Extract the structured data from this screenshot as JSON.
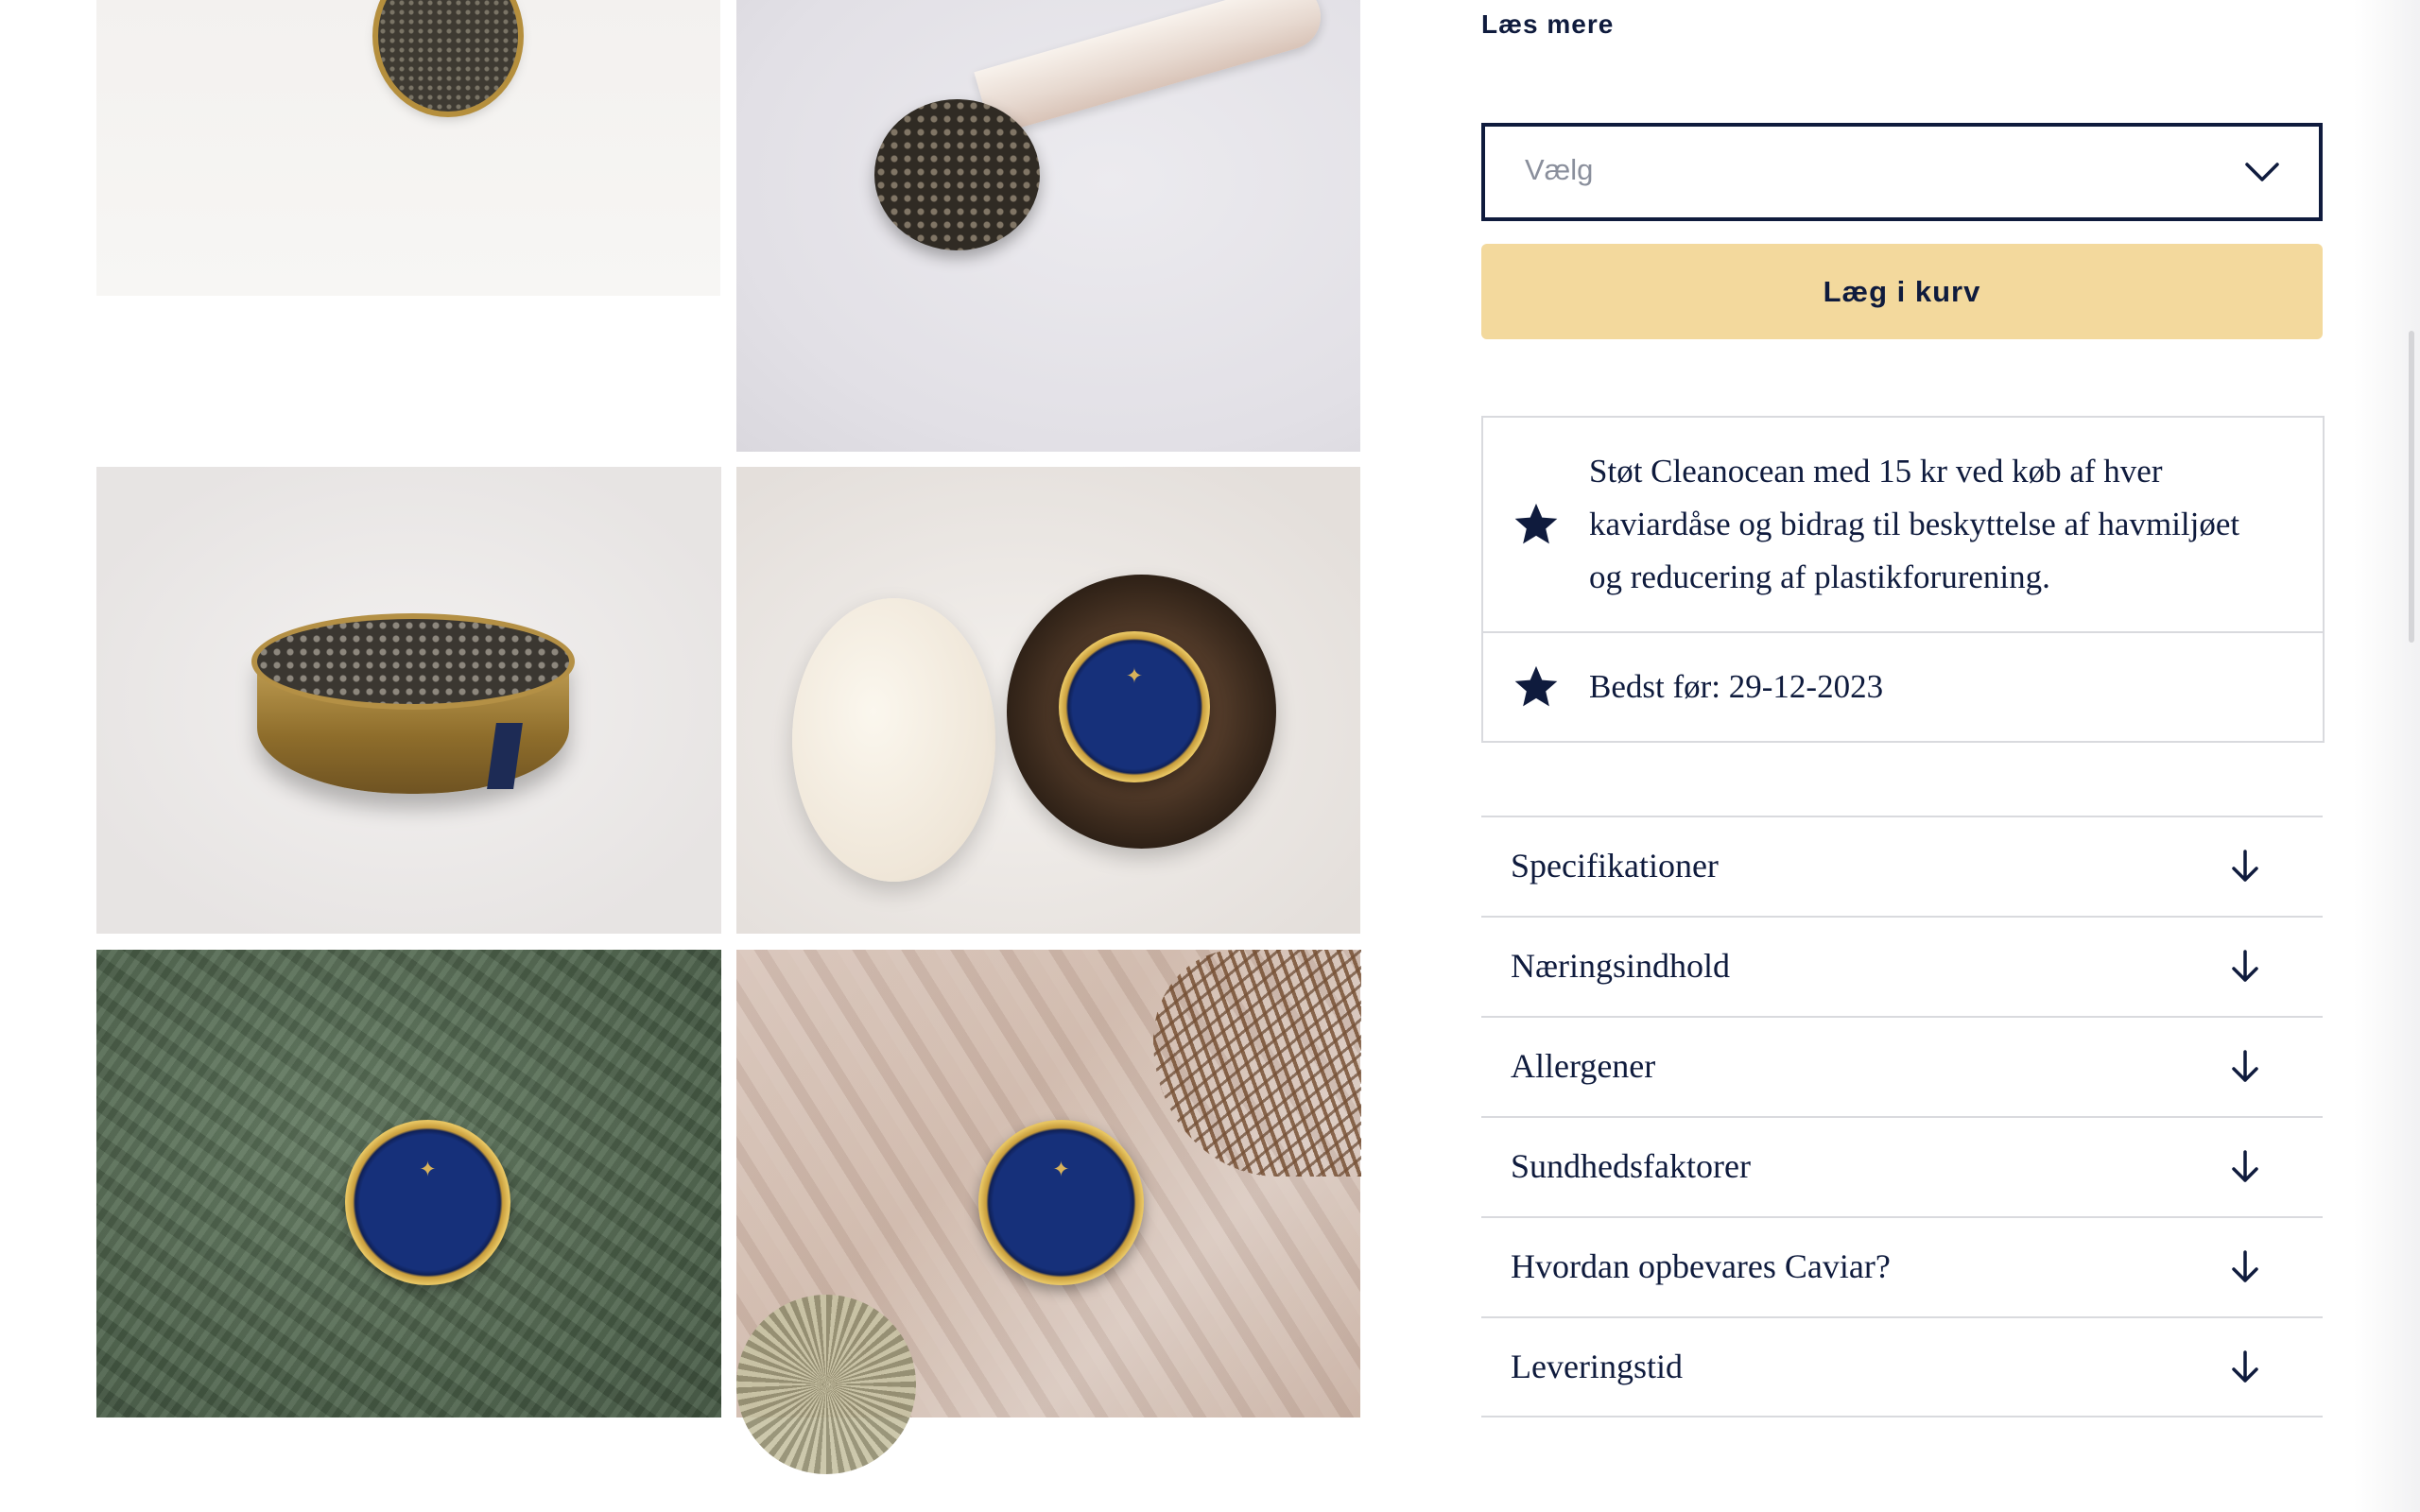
{
  "product": {
    "read_more": "Læs mere",
    "variant_select": {
      "placeholder": "Vælg"
    },
    "add_to_cart_label": "Læg i kurv",
    "info": [
      {
        "icon": "star-icon",
        "text": "Støt Cleanocean med 15 kr ved køb af hver kaviardåse og bidrag til beskyttelse af havmiljøet og reducering af plastikforurening."
      },
      {
        "icon": "star-icon",
        "text": "Bedst før: 29-12-2023"
      }
    ],
    "accordion": [
      {
        "label": "Specifikationer",
        "icon": "arrow-down-icon"
      },
      {
        "label": "Næringsindhold",
        "icon": "arrow-down-icon"
      },
      {
        "label": "Allergener",
        "icon": "arrow-down-icon"
      },
      {
        "label": "Sundhedsfaktorer",
        "icon": "arrow-down-icon"
      },
      {
        "label": "Hvordan opbevares Caviar?",
        "icon": "arrow-down-icon"
      },
      {
        "label": "Leveringstid",
        "icon": "arrow-down-icon"
      }
    ]
  },
  "gallery": {
    "images": [
      "caviar-tin-top-view",
      "caviar-on-mother-of-pearl-spoon",
      "open-caviar-tin-side-view",
      "caviar-tin-in-marble-bowl",
      "caviar-tin-on-green-marble",
      "caviar-tin-on-pink-marble-with-seaweed"
    ]
  },
  "colors": {
    "navy": "#0f1b3d",
    "cart_button": "#f3d99d",
    "border": "#d9dade"
  }
}
